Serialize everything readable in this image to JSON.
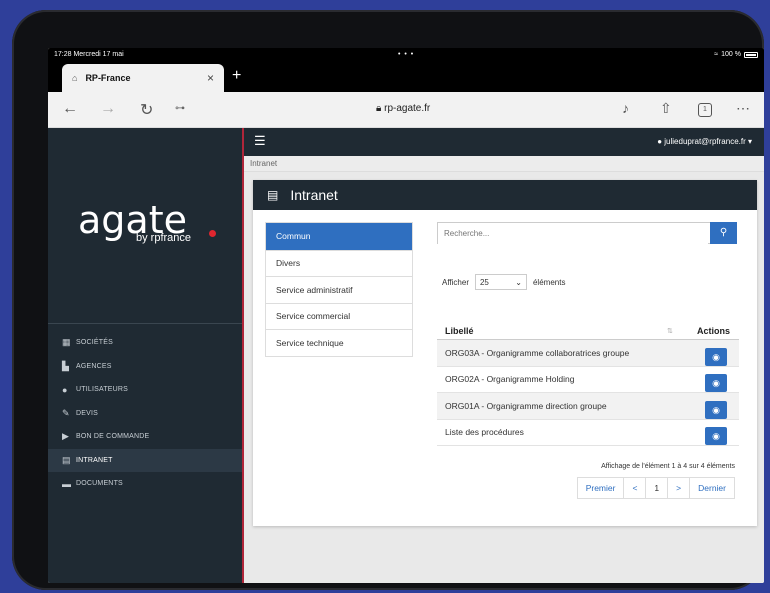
{
  "statusbar": {
    "time": "17:28  Mercredi 17 mai",
    "dots": "• • •",
    "battery": "100 %"
  },
  "browser": {
    "tab_title": "RP-France",
    "url": "rp-agate.fr",
    "tab_count": "1"
  },
  "sidebar": {
    "logo_word": "agate",
    "logo_sub": "by rpfrance",
    "items": [
      {
        "label": "SOCIÉTÉS",
        "icon": "building-icon"
      },
      {
        "label": "AGENCES",
        "icon": "factory-icon"
      },
      {
        "label": "UTILISATEURS",
        "icon": "user-icon"
      },
      {
        "label": "DEVIS",
        "icon": "pen-icon"
      },
      {
        "label": "BON DE COMMANDE",
        "icon": "cart-icon"
      },
      {
        "label": "INTRANET",
        "icon": "document-icon"
      },
      {
        "label": "DOCUMENTS",
        "icon": "folder-icon"
      }
    ]
  },
  "topnav": {
    "user": "julieduprat@rpfrance.fr ▾"
  },
  "breadcrumb": "Intranet",
  "panel": {
    "title": "Intranet",
    "categories": [
      "Commun",
      "Divers",
      "Service administratif",
      "Service commercial",
      "Service technique"
    ],
    "search_placeholder": "Recherche...",
    "length_before": "Afficher",
    "length_value": "25",
    "length_after": "éléments",
    "table": {
      "col_title": "Libellé",
      "col_sort": "⇅",
      "col_actions": "Actions",
      "rows": [
        "ORG03A - Organigramme collaboratrices groupe",
        "ORG02A - Organigramme Holding",
        "ORG01A - Organigramme direction groupe",
        "Liste des procédures"
      ]
    },
    "info": "Affichage de l'élément 1 à 4 sur 4 éléments",
    "pager": {
      "first": "Premier",
      "prev": "<",
      "page": "1",
      "next": ">",
      "last": "Dernier"
    }
  },
  "colors": {
    "accent": "#2f6fc0",
    "sidebar": "#1f2a33",
    "brand_red": "#e0262f"
  }
}
